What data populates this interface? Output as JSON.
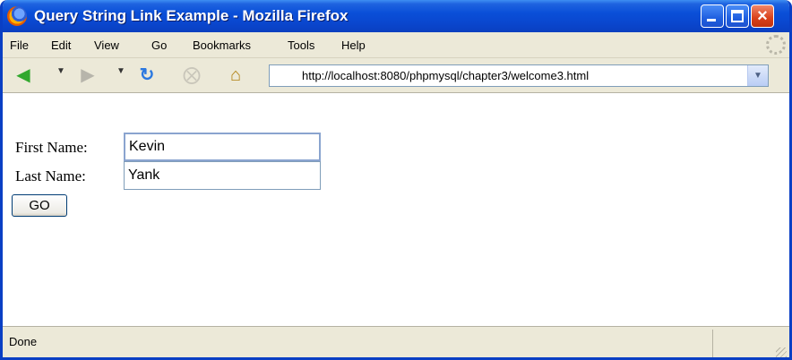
{
  "window": {
    "title": "Query String Link Example - Mozilla Firefox",
    "controls": {
      "minimize": "minimize",
      "maximize": "maximize",
      "close": "×"
    }
  },
  "menubar": {
    "items": [
      "File",
      "Edit",
      "View",
      "Go",
      "Bookmarks",
      "Tools",
      "Help"
    ]
  },
  "navbar": {
    "url": "http://localhost:8080/phpmysql/chapter3/welcome3.html",
    "icons": {
      "back": "back-arrow-icon",
      "forward": "forward-arrow-icon",
      "reload": "reload-icon",
      "stop": "stop-icon",
      "home": "home-icon"
    }
  },
  "form": {
    "first_name_label": "First Name:",
    "first_name_value": "Kevin",
    "last_name_label": "Last Name:",
    "last_name_value": "Yank",
    "submit_label": "GO"
  },
  "statusbar": {
    "text": "Done"
  },
  "colors": {
    "titlebar": "#0a4fd8",
    "chrome": "#ece9d8",
    "close_button": "#d9411a",
    "url_border": "#7f9db9"
  }
}
